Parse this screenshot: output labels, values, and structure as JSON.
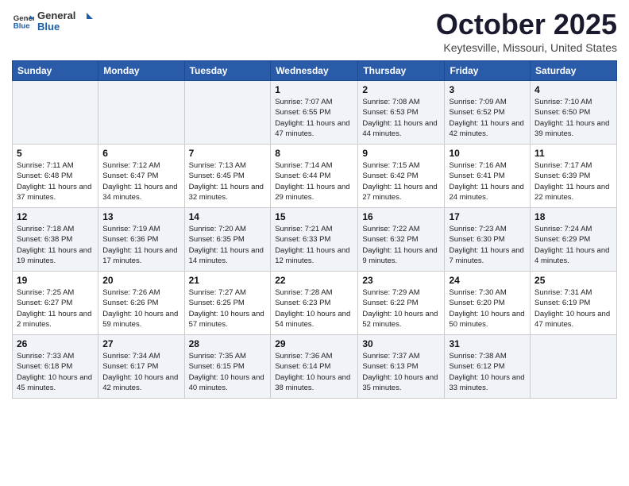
{
  "header": {
    "logo_general": "General",
    "logo_blue": "Blue",
    "month": "October 2025",
    "location": "Keytesville, Missouri, United States"
  },
  "days_of_week": [
    "Sunday",
    "Monday",
    "Tuesday",
    "Wednesday",
    "Thursday",
    "Friday",
    "Saturday"
  ],
  "weeks": [
    [
      {
        "day": "",
        "info": ""
      },
      {
        "day": "",
        "info": ""
      },
      {
        "day": "",
        "info": ""
      },
      {
        "day": "1",
        "info": "Sunrise: 7:07 AM\nSunset: 6:55 PM\nDaylight: 11 hours and 47 minutes."
      },
      {
        "day": "2",
        "info": "Sunrise: 7:08 AM\nSunset: 6:53 PM\nDaylight: 11 hours and 44 minutes."
      },
      {
        "day": "3",
        "info": "Sunrise: 7:09 AM\nSunset: 6:52 PM\nDaylight: 11 hours and 42 minutes."
      },
      {
        "day": "4",
        "info": "Sunrise: 7:10 AM\nSunset: 6:50 PM\nDaylight: 11 hours and 39 minutes."
      }
    ],
    [
      {
        "day": "5",
        "info": "Sunrise: 7:11 AM\nSunset: 6:48 PM\nDaylight: 11 hours and 37 minutes."
      },
      {
        "day": "6",
        "info": "Sunrise: 7:12 AM\nSunset: 6:47 PM\nDaylight: 11 hours and 34 minutes."
      },
      {
        "day": "7",
        "info": "Sunrise: 7:13 AM\nSunset: 6:45 PM\nDaylight: 11 hours and 32 minutes."
      },
      {
        "day": "8",
        "info": "Sunrise: 7:14 AM\nSunset: 6:44 PM\nDaylight: 11 hours and 29 minutes."
      },
      {
        "day": "9",
        "info": "Sunrise: 7:15 AM\nSunset: 6:42 PM\nDaylight: 11 hours and 27 minutes."
      },
      {
        "day": "10",
        "info": "Sunrise: 7:16 AM\nSunset: 6:41 PM\nDaylight: 11 hours and 24 minutes."
      },
      {
        "day": "11",
        "info": "Sunrise: 7:17 AM\nSunset: 6:39 PM\nDaylight: 11 hours and 22 minutes."
      }
    ],
    [
      {
        "day": "12",
        "info": "Sunrise: 7:18 AM\nSunset: 6:38 PM\nDaylight: 11 hours and 19 minutes."
      },
      {
        "day": "13",
        "info": "Sunrise: 7:19 AM\nSunset: 6:36 PM\nDaylight: 11 hours and 17 minutes."
      },
      {
        "day": "14",
        "info": "Sunrise: 7:20 AM\nSunset: 6:35 PM\nDaylight: 11 hours and 14 minutes."
      },
      {
        "day": "15",
        "info": "Sunrise: 7:21 AM\nSunset: 6:33 PM\nDaylight: 11 hours and 12 minutes."
      },
      {
        "day": "16",
        "info": "Sunrise: 7:22 AM\nSunset: 6:32 PM\nDaylight: 11 hours and 9 minutes."
      },
      {
        "day": "17",
        "info": "Sunrise: 7:23 AM\nSunset: 6:30 PM\nDaylight: 11 hours and 7 minutes."
      },
      {
        "day": "18",
        "info": "Sunrise: 7:24 AM\nSunset: 6:29 PM\nDaylight: 11 hours and 4 minutes."
      }
    ],
    [
      {
        "day": "19",
        "info": "Sunrise: 7:25 AM\nSunset: 6:27 PM\nDaylight: 11 hours and 2 minutes."
      },
      {
        "day": "20",
        "info": "Sunrise: 7:26 AM\nSunset: 6:26 PM\nDaylight: 10 hours and 59 minutes."
      },
      {
        "day": "21",
        "info": "Sunrise: 7:27 AM\nSunset: 6:25 PM\nDaylight: 10 hours and 57 minutes."
      },
      {
        "day": "22",
        "info": "Sunrise: 7:28 AM\nSunset: 6:23 PM\nDaylight: 10 hours and 54 minutes."
      },
      {
        "day": "23",
        "info": "Sunrise: 7:29 AM\nSunset: 6:22 PM\nDaylight: 10 hours and 52 minutes."
      },
      {
        "day": "24",
        "info": "Sunrise: 7:30 AM\nSunset: 6:20 PM\nDaylight: 10 hours and 50 minutes."
      },
      {
        "day": "25",
        "info": "Sunrise: 7:31 AM\nSunset: 6:19 PM\nDaylight: 10 hours and 47 minutes."
      }
    ],
    [
      {
        "day": "26",
        "info": "Sunrise: 7:33 AM\nSunset: 6:18 PM\nDaylight: 10 hours and 45 minutes."
      },
      {
        "day": "27",
        "info": "Sunrise: 7:34 AM\nSunset: 6:17 PM\nDaylight: 10 hours and 42 minutes."
      },
      {
        "day": "28",
        "info": "Sunrise: 7:35 AM\nSunset: 6:15 PM\nDaylight: 10 hours and 40 minutes."
      },
      {
        "day": "29",
        "info": "Sunrise: 7:36 AM\nSunset: 6:14 PM\nDaylight: 10 hours and 38 minutes."
      },
      {
        "day": "30",
        "info": "Sunrise: 7:37 AM\nSunset: 6:13 PM\nDaylight: 10 hours and 35 minutes."
      },
      {
        "day": "31",
        "info": "Sunrise: 7:38 AM\nSunset: 6:12 PM\nDaylight: 10 hours and 33 minutes."
      },
      {
        "day": "",
        "info": ""
      }
    ]
  ]
}
